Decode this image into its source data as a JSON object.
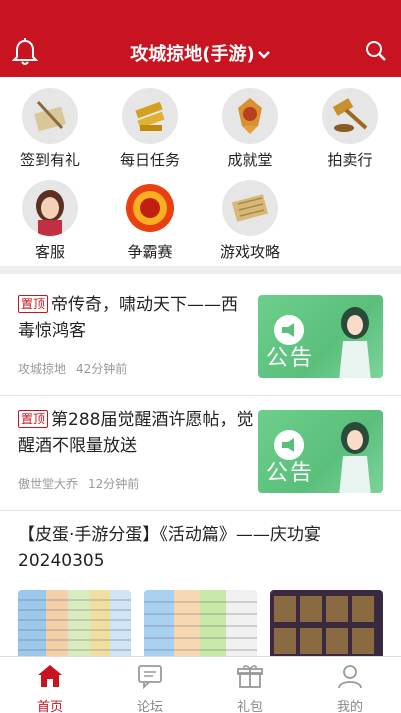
{
  "header": {
    "title": "攻城掠地(手游)"
  },
  "shortcuts": [
    {
      "label": "签到有礼"
    },
    {
      "label": "每日任务"
    },
    {
      "label": "成就堂"
    },
    {
      "label": "拍卖行"
    },
    {
      "label": "客服"
    },
    {
      "label": "争霸赛"
    },
    {
      "label": "游戏攻略"
    }
  ],
  "posts": [
    {
      "pin": "置顶",
      "title": "帝传奇，啸动天下——西毒惊鸿客",
      "author": "攻城掠地",
      "time": "42分钟前",
      "thumb_text": "公告"
    },
    {
      "pin": "置顶",
      "title": "第288届觉醒酒许愿帖，觉醒酒不限量放送",
      "author": "傲世堂大乔",
      "time": "12分钟前",
      "thumb_text": "公告"
    }
  ],
  "long_post": {
    "title": "【皮蛋·手游分蛋】《活动篇》——庆功宴20240305"
  },
  "tabs": [
    {
      "label": "首页"
    },
    {
      "label": "论坛"
    },
    {
      "label": "礼包"
    },
    {
      "label": "我的"
    }
  ],
  "colors": {
    "brand": "#c81420",
    "notice_green": "#6ccf8c"
  }
}
